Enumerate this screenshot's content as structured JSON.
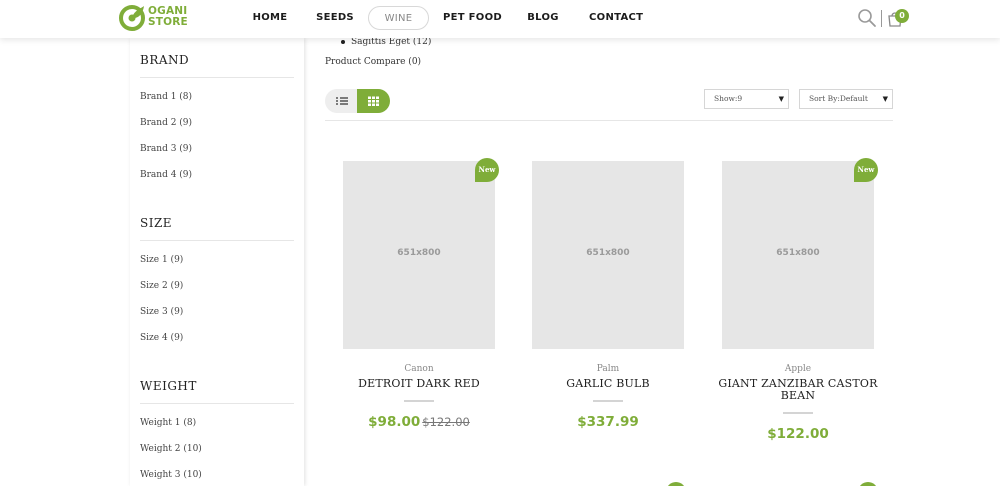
{
  "header": {
    "logo_line1": "OGANI",
    "logo_line2": "STORE",
    "nav": [
      {
        "label": "HOME"
      },
      {
        "label": "SEEDS"
      },
      {
        "label": "WINE"
      },
      {
        "label": "PET FOOD"
      },
      {
        "label": "BLOG"
      },
      {
        "label": "CONTACT"
      }
    ],
    "active_nav": "WINE",
    "cart_count": "0",
    "icons": [
      "search-icon",
      "shopping-bag-icon"
    ]
  },
  "colors": {
    "accent": "#7fad39",
    "image_placeholder": "#e6e6e6"
  },
  "sidebar": {
    "brand": {
      "heading": "BRAND",
      "items": [
        "Brand 1 (8)",
        "Brand 2 (9)",
        "Brand 3 (9)",
        "Brand 4 (9)"
      ]
    },
    "size": {
      "heading": "SIZE",
      "items": [
        "Size 1 (9)",
        "Size 2 (9)",
        "Size 3 (9)",
        "Size 4 (9)"
      ]
    },
    "weight": {
      "heading": "WEIGHT",
      "items": [
        "Weight 1 (8)",
        "Weight 2 (10)",
        "Weight 3 (10)"
      ]
    }
  },
  "content": {
    "top_list_item": "Sagittis Eget (12)",
    "product_compare": "Product Compare (0)",
    "show_select": "Show:9",
    "sort_select": "Sort By:Default",
    "view_modes": [
      "list-view-icon",
      "grid-view-icon"
    ]
  },
  "products": [
    {
      "image_label": "651x800",
      "badge": "New",
      "brand": "Canon",
      "name": "DETROIT DARK RED",
      "price": "$98.00",
      "old_price": "$122.00"
    },
    {
      "image_label": "651x800",
      "badge": "",
      "brand": "Palm",
      "name": "GARLIC BULB",
      "price": "$337.99",
      "old_price": ""
    },
    {
      "image_label": "651x800",
      "badge": "New",
      "brand": "Apple",
      "name_line1": "GIANT ZANZIBAR CASTOR",
      "name_line2": "BEAN",
      "price": "$122.00",
      "old_price": ""
    }
  ]
}
